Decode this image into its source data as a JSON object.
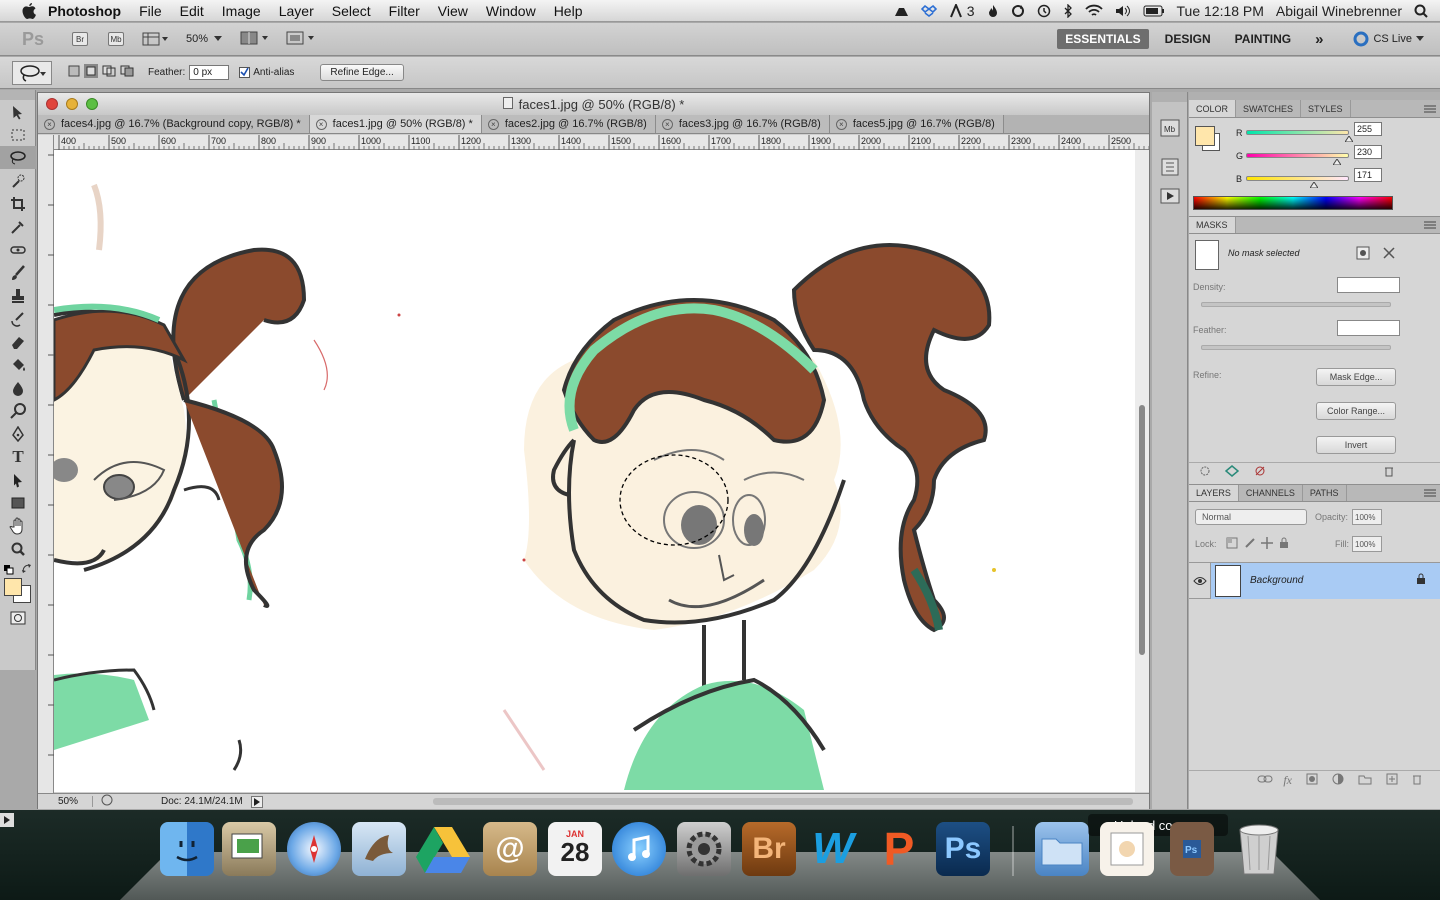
{
  "menubar": {
    "app_name": "Photoshop",
    "items": [
      "File",
      "Edit",
      "Image",
      "Layer",
      "Select",
      "Filter",
      "View",
      "Window",
      "Help"
    ],
    "status_badge": "3",
    "clock": "Tue 12:18 PM",
    "user": "Abigail Winebrenner"
  },
  "appbar": {
    "logo": "Ps",
    "bridge": "Br",
    "minibridge": "Mb",
    "zoom": "50%",
    "workspaces": [
      "ESSENTIALS",
      "DESIGN",
      "PAINTING"
    ],
    "more": "»",
    "cs_live": "CS Live"
  },
  "options": {
    "feather_label": "Feather:",
    "feather_value": "0 px",
    "antialias_label": "Anti-alias",
    "refine_edge": "Refine Edge..."
  },
  "document": {
    "title": "faces1.jpg @ 50% (RGB/8) *",
    "tabs": [
      "faces4.jpg @ 16.7% (Background copy, RGB/8) *",
      "faces1.jpg @ 50% (RGB/8) *",
      "faces2.jpg @ 16.7% (RGB/8)",
      "faces3.jpg @ 16.7% (RGB/8)",
      "faces5.jpg @ 16.7% (RGB/8)"
    ],
    "ruler_ticks": [
      "400",
      "500",
      "600",
      "700",
      "800",
      "900",
      "1000",
      "1100",
      "1200",
      "1300",
      "1400",
      "1500",
      "1600",
      "1700",
      "1800",
      "1900",
      "2000",
      "2100",
      "2200",
      "2300",
      "2400",
      "2500"
    ],
    "status_zoom": "50%",
    "doc_size": "Doc: 24.1M/24.1M"
  },
  "color_panel": {
    "tabs": [
      "COLOR",
      "SWATCHES",
      "STYLES"
    ],
    "r_label": "R",
    "r_value": "255",
    "g_label": "G",
    "g_value": "230",
    "b_label": "B",
    "b_value": "171",
    "foreground": "#ffe6ab"
  },
  "masks_panel": {
    "title": "MASKS",
    "no_mask": "No mask selected",
    "density": "Density:",
    "feather": "Feather:",
    "refine": "Refine:",
    "mask_edge": "Mask Edge...",
    "color_range": "Color Range...",
    "invert": "Invert"
  },
  "layers_panel": {
    "tabs": [
      "LAYERS",
      "CHANNELS",
      "PATHS"
    ],
    "blend_mode": "Normal",
    "opacity_label": "Opacity:",
    "opacity_value": "100%",
    "lock_label": "Lock:",
    "fill_label": "Fill:",
    "fill_value": "100%",
    "layer_name": "Background"
  },
  "dock": {
    "calendar_month": "JAN",
    "calendar_day": "28",
    "upload_label": "Upload co"
  }
}
